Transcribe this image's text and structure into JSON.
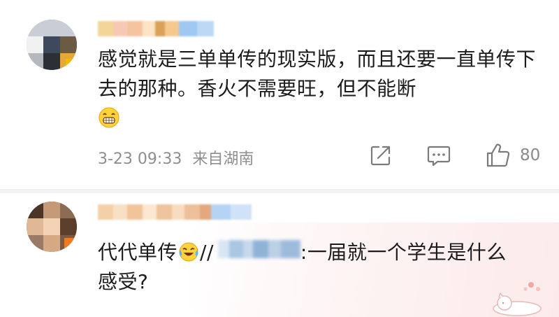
{
  "comments": [
    {
      "username": "",
      "text": "感觉就是三单单传的现实版，而且还要一直单传下去的那种。香火不需要旺，但不能断",
      "emoji": "grin-emoji",
      "meta": {
        "date": "3-23 09:33",
        "location": "来自湖南"
      },
      "actions": {
        "repost_icon": "share-box-icon",
        "comment_icon": "comment-bubble-icon",
        "like_icon": "thumbs-up-icon",
        "like_count": "80"
      }
    },
    {
      "username": "",
      "text_before": "代代单传",
      "emoji": "tears-of-joy-emoji",
      "repost_marker": "//",
      "quoted_user": "",
      "quoted_text": ":一届就一个学生是什么感受?"
    }
  ],
  "colors": {
    "text": "#1c1c1c",
    "meta": "#8e8e8e",
    "divider": "#f2f2f2",
    "bubble": "#fce8e8"
  }
}
